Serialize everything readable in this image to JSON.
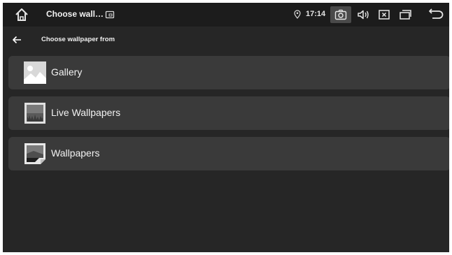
{
  "status_bar": {
    "app_title": "Choose wall…",
    "time": "17:14",
    "icons": [
      "home-icon",
      "screenshot-icon",
      "location-icon",
      "camera-icon",
      "volume-icon",
      "close-box-icon",
      "recent-apps-icon",
      "back-icon"
    ]
  },
  "action_bar": {
    "title": "Choose wallpaper from"
  },
  "options": [
    {
      "label": "Gallery",
      "icon": "gallery-icon"
    },
    {
      "label": "Live Wallpapers",
      "icon": "live-wallpapers-icon"
    },
    {
      "label": "Wallpapers",
      "icon": "wallpapers-icon"
    }
  ],
  "colors": {
    "background": "#262626",
    "status_bar": "#1c1c1c",
    "option_background": "#3a3a3a",
    "text": "#f2f2f2"
  }
}
